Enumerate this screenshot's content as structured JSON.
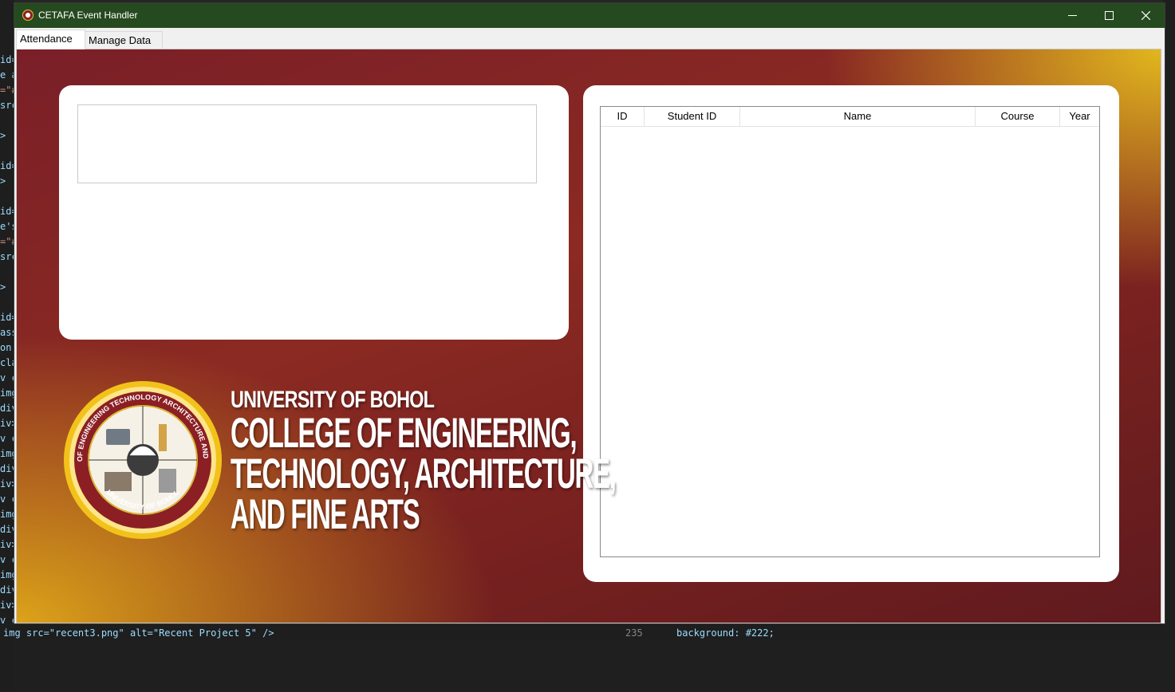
{
  "window": {
    "title": "CETAFA Event Handler"
  },
  "tabs": [
    {
      "label": "Attendance"
    },
    {
      "label": "Manage Data"
    }
  ],
  "attendance_table": {
    "columns": [
      "ID",
      "Student ID",
      "Name",
      "Course",
      "Year"
    ],
    "rows": []
  },
  "branding": {
    "university": "UNIVERSITY OF BOHOL",
    "college_lines": [
      "COLLEGE OF ENGINEERING,",
      "TECHNOLOGY, ARCHITECTURE,",
      "AND FINE ARTS"
    ],
    "seal_outer_text": "COLLEGE OF ENGINEERING TECHNOLOGY ARCHITECTURE AND FINE ARTS",
    "seal_bottom_text": "UNIVERSITY OF BOHOL"
  },
  "background_editor": {
    "left_lines": [
      "id=",
      "e a",
      "=\"#",
      "src",
      "",
      ">",
      "",
      "id=",
      ">",
      "",
      "id=",
      "e's",
      "=\"#",
      "src",
      "",
      ">",
      "",
      "id=",
      "ass",
      "on ",
      "cla",
      "v c",
      "img",
      "div",
      "iv>",
      "v c",
      "img",
      "div",
      "iv>",
      "v c",
      "img",
      "div",
      "iv>",
      "v c",
      "img",
      "div",
      "iv>",
      "v c"
    ],
    "bottom_code": "img src=\"recent3.png\" alt=\"Recent Project 5\" />",
    "bottom_line_number": "235",
    "bottom_right_code": "background: #222;"
  },
  "colors": {
    "titlebar": "#264a1f",
    "maroon": "#7a1f28",
    "gold": "#e6be1e"
  }
}
